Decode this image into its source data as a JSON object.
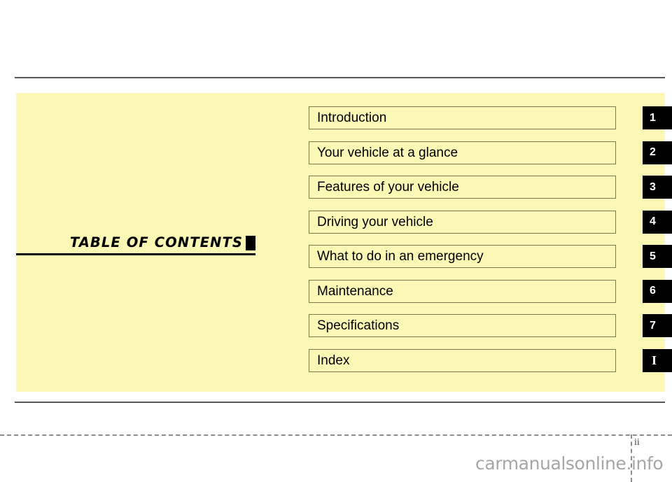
{
  "page": {
    "heading": "TABLE  OF  CONTENTS",
    "page_number": "ii",
    "watermark": "carmanualsonline.info",
    "colors": {
      "panel_background": "#fbf7b5",
      "box_border": "#7b7a52",
      "tab_background": "#000000",
      "tab_text": "#ffffff",
      "rule": "#565656",
      "footer_dash": "#8d8d8d",
      "watermark_text": "#a6a6a6"
    }
  },
  "contents": [
    {
      "label": "Introduction",
      "tab": "1"
    },
    {
      "label": "Your vehicle at a glance",
      "tab": "2"
    },
    {
      "label": "Features of your vehicle",
      "tab": "3"
    },
    {
      "label": "Driving your vehicle",
      "tab": "4"
    },
    {
      "label": "What to do in an emergency",
      "tab": "5"
    },
    {
      "label": "Maintenance",
      "tab": "6"
    },
    {
      "label": "Specifications",
      "tab": "7"
    },
    {
      "label": "Index",
      "tab": "I"
    }
  ]
}
